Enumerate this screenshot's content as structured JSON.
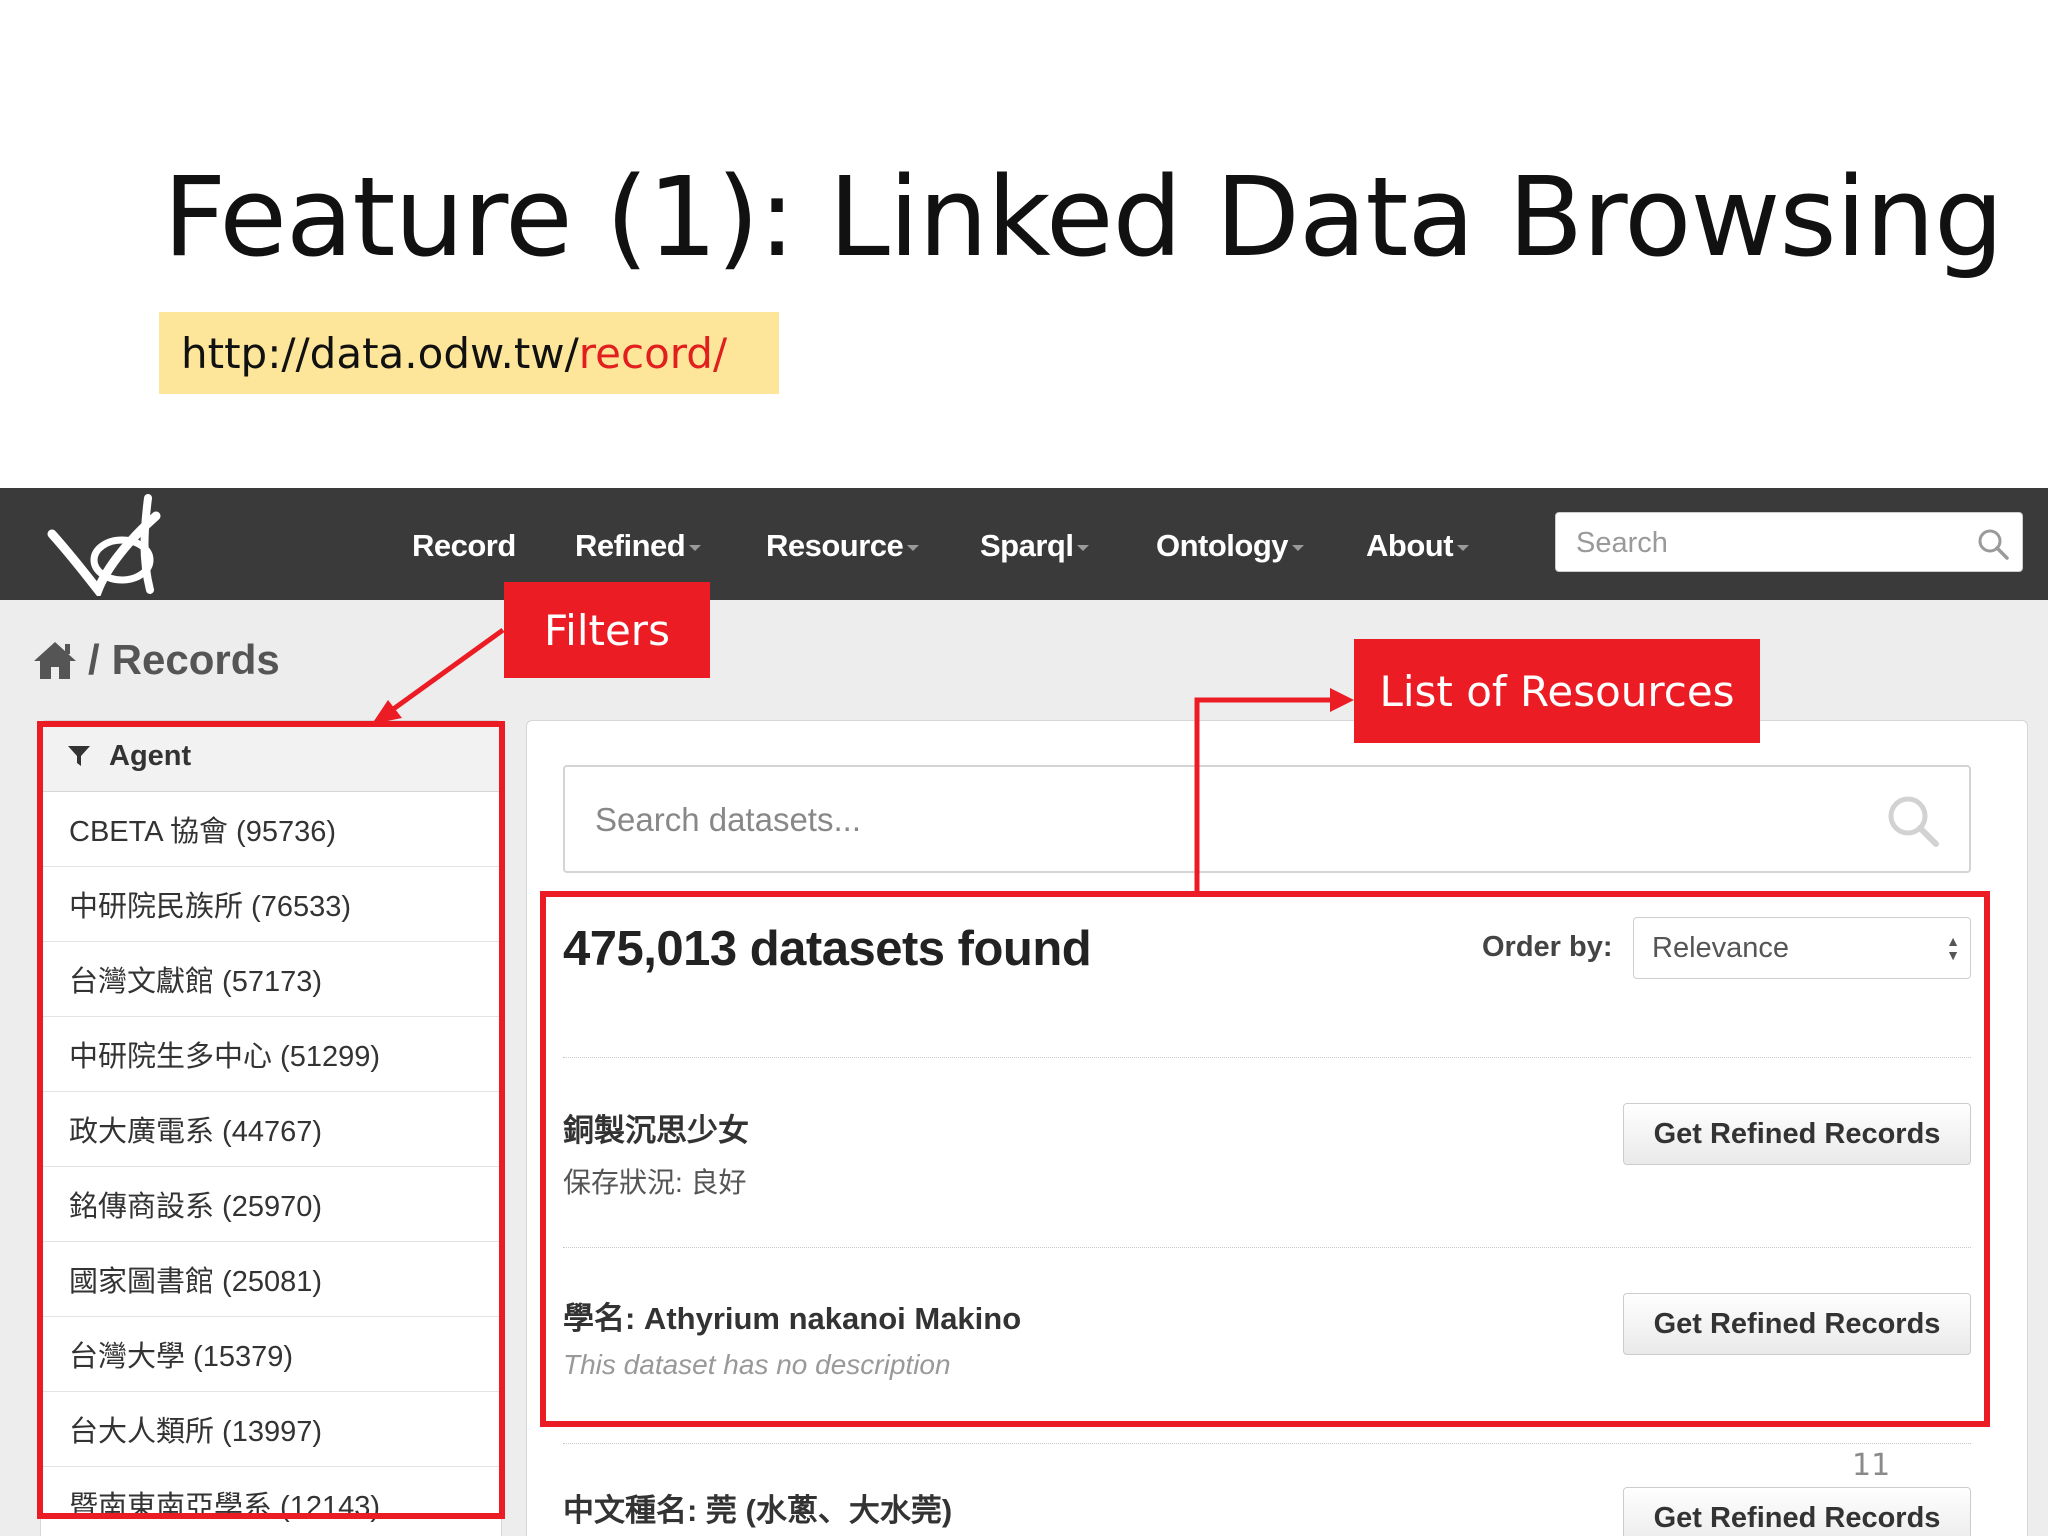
{
  "slide": {
    "title": "Feature (1): Linked Data Browsing",
    "url_base": "http://data.odw.tw/",
    "url_highlight": "record/",
    "page_number": "11"
  },
  "navbar": {
    "items": [
      {
        "label": "Record",
        "has_caret": false
      },
      {
        "label": "Refined",
        "has_caret": true
      },
      {
        "label": "Resource",
        "has_caret": true
      },
      {
        "label": "Sparql",
        "has_caret": true
      },
      {
        "label": "Ontology",
        "has_caret": true
      },
      {
        "label": "About",
        "has_caret": true
      }
    ],
    "search_placeholder": "Search"
  },
  "breadcrumb": {
    "home_icon": "home-icon",
    "separator": "/",
    "current": "Records"
  },
  "sidebar": {
    "facet_title": "Agent",
    "items": [
      {
        "label": "CBETA 協會 (95736)"
      },
      {
        "label": "中研院民族所 (76533)"
      },
      {
        "label": "台灣文獻館 (57173)"
      },
      {
        "label": "中研院生多中心 (51299)"
      },
      {
        "label": "政大廣電系 (44767)"
      },
      {
        "label": "銘傳商設系 (25970)"
      },
      {
        "label": "國家圖書館 (25081)"
      },
      {
        "label": "台灣大學 (15379)"
      },
      {
        "label": "台大人類所 (13997)"
      },
      {
        "label": "暨南東南亞學系 (12143)"
      }
    ]
  },
  "main": {
    "search_placeholder": "Search datasets...",
    "count_text": "475,013 datasets found",
    "order_label": "Order by:",
    "order_value": "Relevance",
    "results": [
      {
        "title": "銅製沉思少女",
        "description": "保存狀況: 良好",
        "button": "Get Refined Records"
      },
      {
        "title": "學名: Athyrium nakanoi Makino",
        "description": "This dataset has no description",
        "button": "Get Refined Records"
      },
      {
        "title": "中文種名: 莞 (水蔥、大水莞)",
        "description": "",
        "button": "Get Refined Records"
      }
    ]
  },
  "annotations": {
    "filters_label": "Filters",
    "resources_label": "List of Resources",
    "color": "#ec1c24"
  },
  "colors": {
    "navbar_bg": "#3a3a3a",
    "url_highlight_bg": "#fde699",
    "url_highlight_text": "#e21f1f"
  }
}
